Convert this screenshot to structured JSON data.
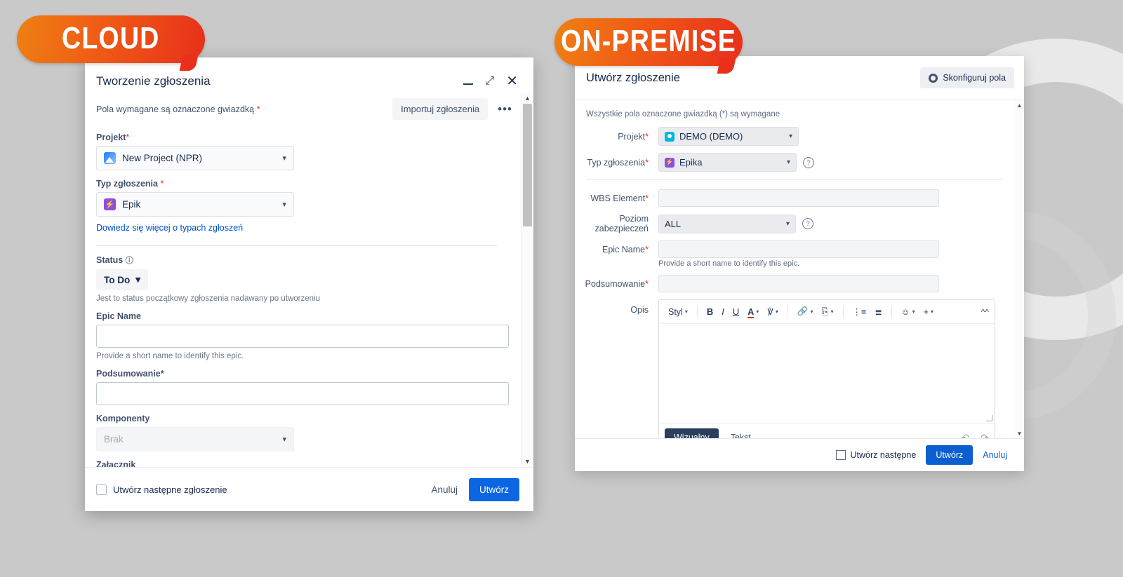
{
  "badges": {
    "cloud": "CLOUD",
    "onpremise": "ON-PREMISE"
  },
  "cloud": {
    "title": "Tworzenie zgłoszenia",
    "window_controls": {
      "minimize": "minimize-icon",
      "collapse": "collapse-icon",
      "close": "close-icon"
    },
    "required_note": "Pola wymagane są oznaczone gwiazdką",
    "required_asterisk": "*",
    "import_button": "Importuj zgłoszenia",
    "more_menu": "•••",
    "fields": {
      "project_label": "Projekt",
      "project_value": "New Project (NPR)",
      "issue_type_label": "Typ zgłoszenia",
      "issue_type_value": "Epik",
      "issue_type_link": "Dowiedz się więcej o typach zgłoszeń",
      "status_label": "Status",
      "status_value": "To Do",
      "status_help": "Jest to status początkowy zgłoszenia nadawany po utworzeniu",
      "epic_name_label": "Epic Name",
      "epic_name_value": "",
      "epic_name_help": "Provide a short name to identify this epic.",
      "summary_label": "Podsumowanie",
      "summary_value": "",
      "components_label": "Komponenty",
      "components_value": "Brak",
      "attachment_label": "Załącznik"
    },
    "footer": {
      "create_next": "Utwórz następne zgłoszenie",
      "cancel": "Anuluj",
      "create": "Utwórz"
    }
  },
  "onpremise": {
    "title": "Utwórz zgłoszenie",
    "configure_button": "Skonfiguruj pola",
    "required_note": "Wszystkie pola oznaczone gwiazdką (*) są wymagane",
    "fields": {
      "project_label": "Projekt",
      "project_value": "DEMO (DEMO)",
      "issue_type_label": "Typ zgłoszenia",
      "issue_type_value": "Epika",
      "wbs_label": "WBS Element",
      "wbs_value": "",
      "security_label": "Poziom zabezpieczeń",
      "security_value": "ALL",
      "epic_name_label": "Epic Name",
      "epic_name_value": "",
      "epic_name_help": "Provide a short name to identify this epic.",
      "summary_label": "Podsumowanie",
      "summary_value": "",
      "description_label": "Opis"
    },
    "editor": {
      "style": "Styl",
      "bold": "B",
      "italic": "I",
      "underline": "U",
      "text_color": "A",
      "highlight": "A",
      "link": "link-icon",
      "attach": "attach-icon",
      "bullet_list": "bullet-list-icon",
      "numbered_list": "numbered-list-icon",
      "emoji": "emoji-icon",
      "plus": "+",
      "collapse": "collapse-toolbar-icon",
      "tab_visual": "Wizualny",
      "tab_text": "Tekst",
      "undo": "undo-icon",
      "redo": "redo-icon"
    },
    "footer": {
      "create_next": "Utwórz następne",
      "create": "Utwórz",
      "cancel": "Anuluj"
    }
  },
  "colors": {
    "badge_start": "#ef8013",
    "badge_end": "#e8301b",
    "primary_blue": "#0c66e4",
    "link_blue": "#0052cc",
    "required_red": "#de350b",
    "background": "#c9c9c9"
  }
}
